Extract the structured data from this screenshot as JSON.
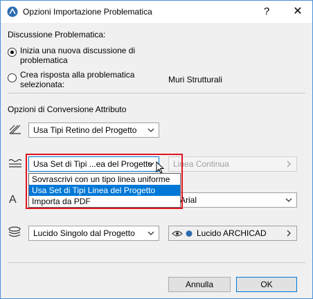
{
  "dialog": {
    "title": "Opzioni Importazione Problematica",
    "help_label": "?",
    "close_label": "✕"
  },
  "discussion": {
    "heading": "Discussione Problematica:",
    "option_new_line1": "Inizia una nuova discussione di",
    "option_new_line2": "problematica",
    "option_reply_line1": "Crea risposta alla problematica",
    "option_reply_line2": "selezionata:",
    "selected_issue": "Muri Strutturali"
  },
  "conversion": {
    "heading": "Opzioni di Conversione Attributo",
    "fill_select": "Usa Tipi Retino del Progetto",
    "line_select": "Usa Set di Tipi ...ea del Progetto",
    "line_type_select": "Linea Continua",
    "font_select": "Arial",
    "layer_select": "Lucido Singolo dal Progetto",
    "layer_value": "Lucido ARCHICAD"
  },
  "dropdown": {
    "options": [
      "Sovrascrivi con un tipo linea uniforme",
      "Usa Set di Tipi Linea del Progetto",
      "Importa da PDF"
    ],
    "selected_index": 1
  },
  "footer": {
    "cancel_label": "Annulla",
    "ok_label": "OK"
  },
  "colors": {
    "accent": "#0078d7",
    "highlight_box": "#e0141e"
  }
}
